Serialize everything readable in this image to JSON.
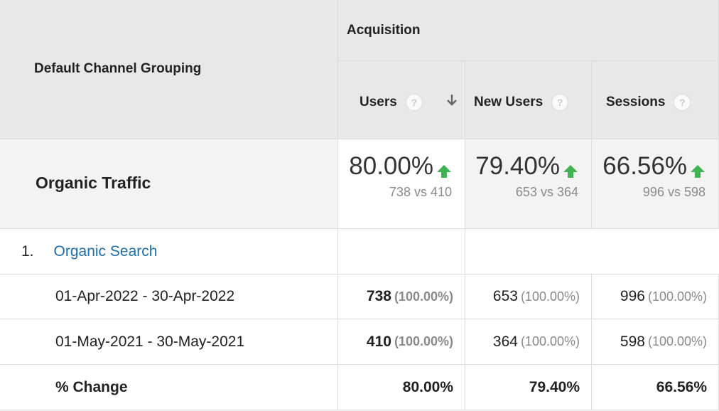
{
  "header": {
    "group_label": "Default Channel Grouping",
    "section_label": "Acquisition",
    "columns": [
      {
        "label": "Users",
        "help": "?"
      },
      {
        "label": "New Users",
        "help": "?"
      },
      {
        "label": "Sessions",
        "help": "?"
      }
    ]
  },
  "segment": {
    "label": "Organic Traffic",
    "metrics": [
      {
        "pct": "80.00%",
        "vs": "738 vs 410"
      },
      {
        "pct": "79.40%",
        "vs": "653 vs 364"
      },
      {
        "pct": "66.56%",
        "vs": "996 vs 598"
      }
    ]
  },
  "rows": {
    "channel_index": "1.",
    "channel_name": "Organic Search",
    "periods": [
      {
        "label": "01-Apr-2022 - 30-Apr-2022",
        "values": [
          {
            "v": "738",
            "p": "(100.00%)"
          },
          {
            "v": "653",
            "p": "(100.00%)"
          },
          {
            "v": "996",
            "p": "(100.00%)"
          }
        ]
      },
      {
        "label": "01-May-2021 - 30-May-2021",
        "values": [
          {
            "v": "410",
            "p": "(100.00%)"
          },
          {
            "v": "364",
            "p": "(100.00%)"
          },
          {
            "v": "598",
            "p": "(100.00%)"
          }
        ]
      }
    ],
    "change": {
      "label": "% Change",
      "values": [
        "80.00%",
        "79.40%",
        "66.56%"
      ]
    }
  },
  "colors": {
    "up_arrow": "#3eb34f",
    "link": "#1a6eb0",
    "header_bg": "#e8e8e8"
  }
}
